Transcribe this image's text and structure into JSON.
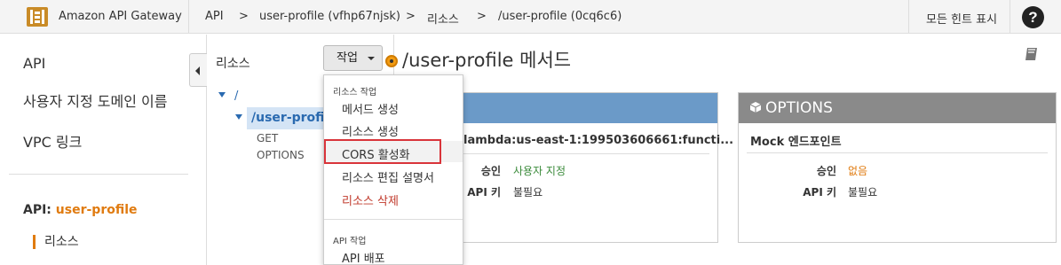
{
  "topbar": {
    "brand": "Amazon API Gateway",
    "breadcrumbs": [
      "API",
      ">",
      "user-profile (vfhp67njsk)",
      ">",
      "리소스",
      ">",
      "/user-profile (0cq6c6)"
    ],
    "show_hints": "모든 힌트 표시",
    "help": "?"
  },
  "leftnav": {
    "items": [
      "API",
      "사용자 지정 도메인 이름",
      "VPC 링크"
    ],
    "api_prefix": "API:",
    "api_name": "user-profile",
    "resources": "리소스"
  },
  "resources_panel": {
    "title": "리소스",
    "action_button": "작업",
    "tree": {
      "root": "/",
      "resource": "/user-profile",
      "methods": [
        "GET",
        "OPTIONS"
      ]
    }
  },
  "main": {
    "title": "/user-profile 메서드",
    "card_left": {
      "subtitle": "lambda:us-east-1:199503606661:functi...",
      "rows": [
        {
          "label": "승인",
          "value": "사용자 지정"
        },
        {
          "label": "API 키",
          "value": "불필요"
        }
      ]
    },
    "card_right": {
      "header": "OPTIONS",
      "subtitle": "Mock 엔드포인트",
      "rows": [
        {
          "label": "승인",
          "value": "없음"
        },
        {
          "label": "API 키",
          "value": "불필요"
        }
      ]
    }
  },
  "dropdown": {
    "section1": "리소스 작업",
    "items1": [
      "메서드 생성",
      "리소스 생성",
      "CORS 활성화",
      "리소스 편집 설명서",
      "리소스 삭제"
    ],
    "section2": "API 작업",
    "items2": [
      "API 배포"
    ]
  },
  "colors": {
    "accent_orange": "#e07b10",
    "link_blue": "#2a6ab0",
    "card_blue": "#6b9ac8",
    "card_gray": "#8a8a8a",
    "highlight_red": "#d9343a"
  }
}
